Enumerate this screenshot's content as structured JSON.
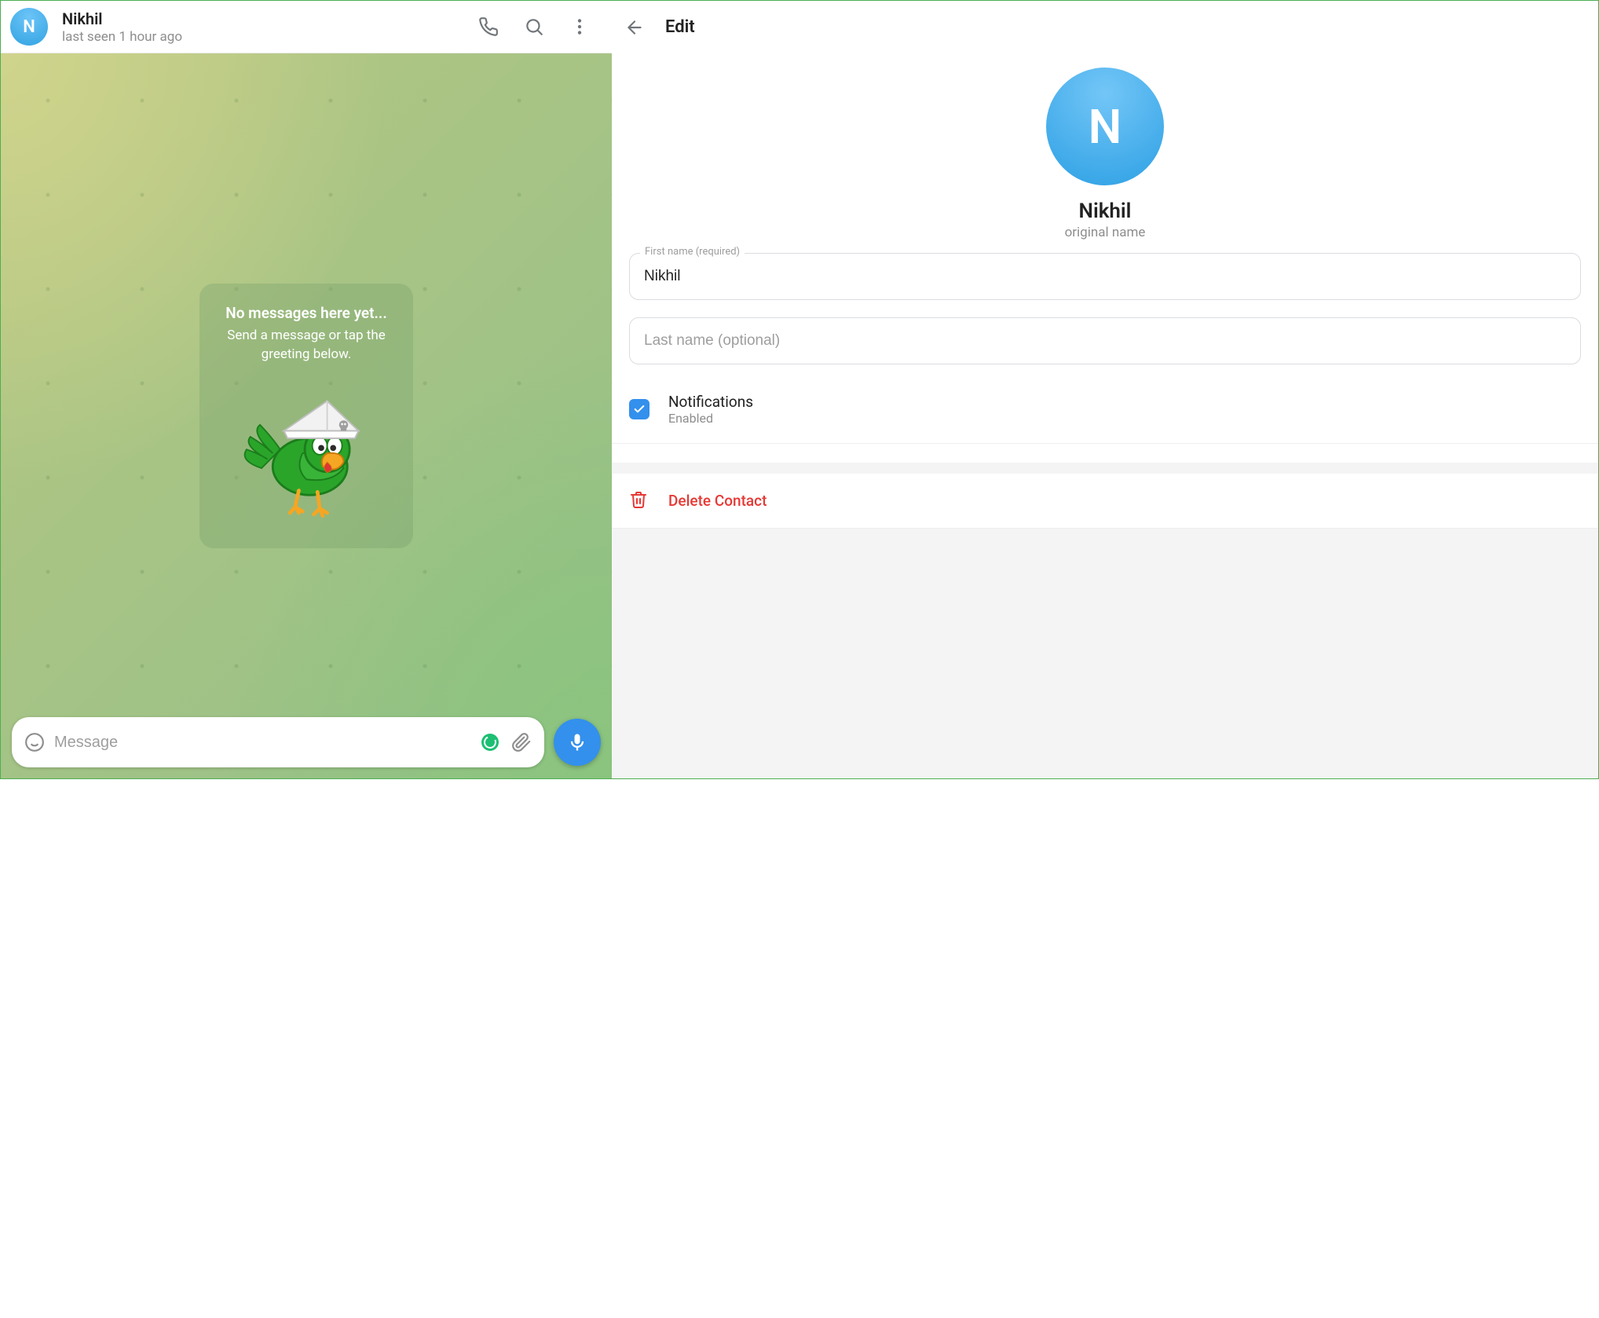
{
  "chat": {
    "header": {
      "avatar_initial": "N",
      "name": "Nikhil",
      "status": "last seen 1 hour ago"
    },
    "placeholder": {
      "title": "No messages here yet...",
      "subtitle": "Send a message or tap the greeting below."
    },
    "input": {
      "placeholder": "Message",
      "value": ""
    }
  },
  "edit": {
    "title": "Edit",
    "avatar_initial": "N",
    "display_name": "Nikhil",
    "subtitle": "original name",
    "first_name": {
      "label": "First name (required)",
      "value": "Nikhil"
    },
    "last_name": {
      "placeholder": "Last name (optional)",
      "value": ""
    },
    "notifications": {
      "title": "Notifications",
      "state": "Enabled",
      "checked": true
    },
    "delete_label": "Delete Contact"
  },
  "colors": {
    "accent": "#3390ec",
    "danger": "#e53935"
  }
}
